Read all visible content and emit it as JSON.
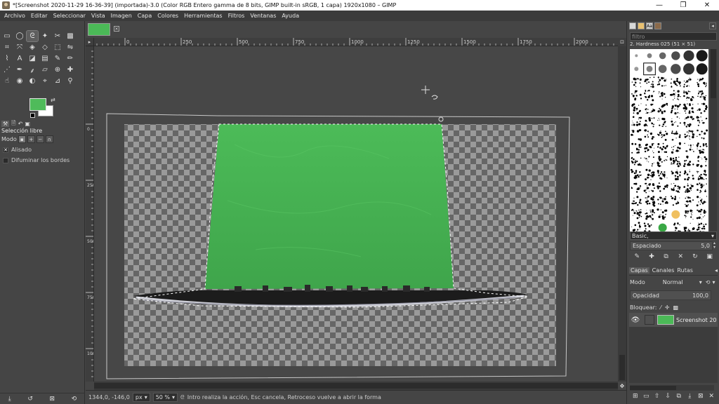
{
  "window": {
    "title": "*[Screenshot 2020-11-29 16-36-39] (importada)-3.0 (Color RGB Entero gamma de 8 bits, GIMP built-in sRGB, 1 capa) 1920x1080 – GIMP",
    "minimize": "—",
    "maximize": "❐",
    "close": "✕"
  },
  "menu": [
    "Archivo",
    "Editar",
    "Seleccionar",
    "Vista",
    "Imagen",
    "Capa",
    "Colores",
    "Herramientas",
    "Filtros",
    "Ventanas",
    "Ayuda"
  ],
  "toolbox": {
    "tools": [
      {
        "icon": "rect-select-icon",
        "glyph": "▭"
      },
      {
        "icon": "ellipse-select-icon",
        "glyph": "◯"
      },
      {
        "icon": "free-select-icon",
        "glyph": "ᘓ",
        "active": true
      },
      {
        "icon": "fuzzy-select-icon",
        "glyph": "✦"
      },
      {
        "icon": "scissors-icon",
        "glyph": "✂"
      },
      {
        "icon": "foreground-select-icon",
        "glyph": "▩"
      },
      {
        "icon": "crop-icon",
        "glyph": "⌗"
      },
      {
        "icon": "unified-transform-icon",
        "glyph": "⤧"
      },
      {
        "icon": "warp-icon",
        "glyph": "◈"
      },
      {
        "icon": "cage-icon",
        "glyph": "◇"
      },
      {
        "icon": "handle-transform-icon",
        "glyph": "⬚"
      },
      {
        "icon": "flip-icon",
        "glyph": "⇋"
      },
      {
        "icon": "path-icon",
        "glyph": "⌇"
      },
      {
        "icon": "text-icon",
        "glyph": "A"
      },
      {
        "icon": "bucket-fill-icon",
        "glyph": "◪"
      },
      {
        "icon": "gradient-icon",
        "glyph": "▤"
      },
      {
        "icon": "paintbrush-icon",
        "glyph": "✎"
      },
      {
        "icon": "pencil-icon",
        "glyph": "✏"
      },
      {
        "icon": "airbrush-icon",
        "glyph": "⋰"
      },
      {
        "icon": "ink-icon",
        "glyph": "✒"
      },
      {
        "icon": "mypaint-icon",
        "glyph": "⸙"
      },
      {
        "icon": "eraser-icon",
        "glyph": "▱"
      },
      {
        "icon": "clone-icon",
        "glyph": "⊕"
      },
      {
        "icon": "heal-icon",
        "glyph": "✚"
      },
      {
        "icon": "smudge-icon",
        "glyph": "☝"
      },
      {
        "icon": "blur-icon",
        "glyph": "◉"
      },
      {
        "icon": "dodge-burn-icon",
        "glyph": "◐"
      },
      {
        "icon": "color-picker-icon",
        "glyph": "⌖"
      },
      {
        "icon": "measure-icon",
        "glyph": "⊿"
      },
      {
        "icon": "zoom-icon",
        "glyph": "⚲"
      }
    ],
    "fg_color": "#4fbb5a",
    "bg_color": "#ffffff",
    "option_tabs": [
      "⚒",
      "🗎",
      "↶",
      "▣"
    ],
    "option_title": "Selección libre",
    "mode_label": "Modo",
    "checks": [
      {
        "label": "Alisado",
        "checked": true,
        "mark": "✕"
      },
      {
        "label": "Difuminar los bordes",
        "checked": false,
        "mark": ""
      }
    ],
    "bottom_buttons": [
      "⤓",
      "↺",
      "⊠",
      "⟲"
    ]
  },
  "image_tab": {
    "close_glyph": "✕"
  },
  "ruler": {
    "h_labels": [
      "0",
      "250",
      "500",
      "750",
      "1000",
      "1250",
      "1500",
      "1750",
      "2000"
    ],
    "v_labels": [
      "0",
      "250",
      "500",
      "750",
      "1000"
    ]
  },
  "status": {
    "coords": "1344,0, -146,0",
    "unit": "px",
    "zoom": "50 %",
    "message": "Intro realiza la acción, Esc cancela, Retroceso vuelve a abrir la forma"
  },
  "dock": {
    "filter_placeholder": "filtro",
    "brush_name": "2. Hardness 025 (51 × 51)",
    "tag_value": "Basic,",
    "spacing_label": "Espaciado",
    "spacing_value": "5,0",
    "brush_buttons": [
      "✎",
      "✚",
      "⧉",
      "✕",
      "↻",
      "▣"
    ],
    "layer_tabs": [
      "Capas",
      "Canales",
      "Rutas"
    ],
    "mode_label": "Modo",
    "mode_value": "Normal",
    "opacity_label": "Opacidad",
    "opacity_value": "100,0",
    "lock_label": "Bloquear:",
    "lock_icons": [
      "⁄",
      "✛",
      "▩"
    ],
    "layer_name": "Screenshot 20",
    "layer_buttons": [
      "⊞",
      "▭",
      "⇧",
      "⇩",
      "⧉",
      "⤓",
      "⊠",
      "✕"
    ]
  },
  "colors": {
    "chroma_green": "#4cba58",
    "ui_bg": "#454545"
  }
}
